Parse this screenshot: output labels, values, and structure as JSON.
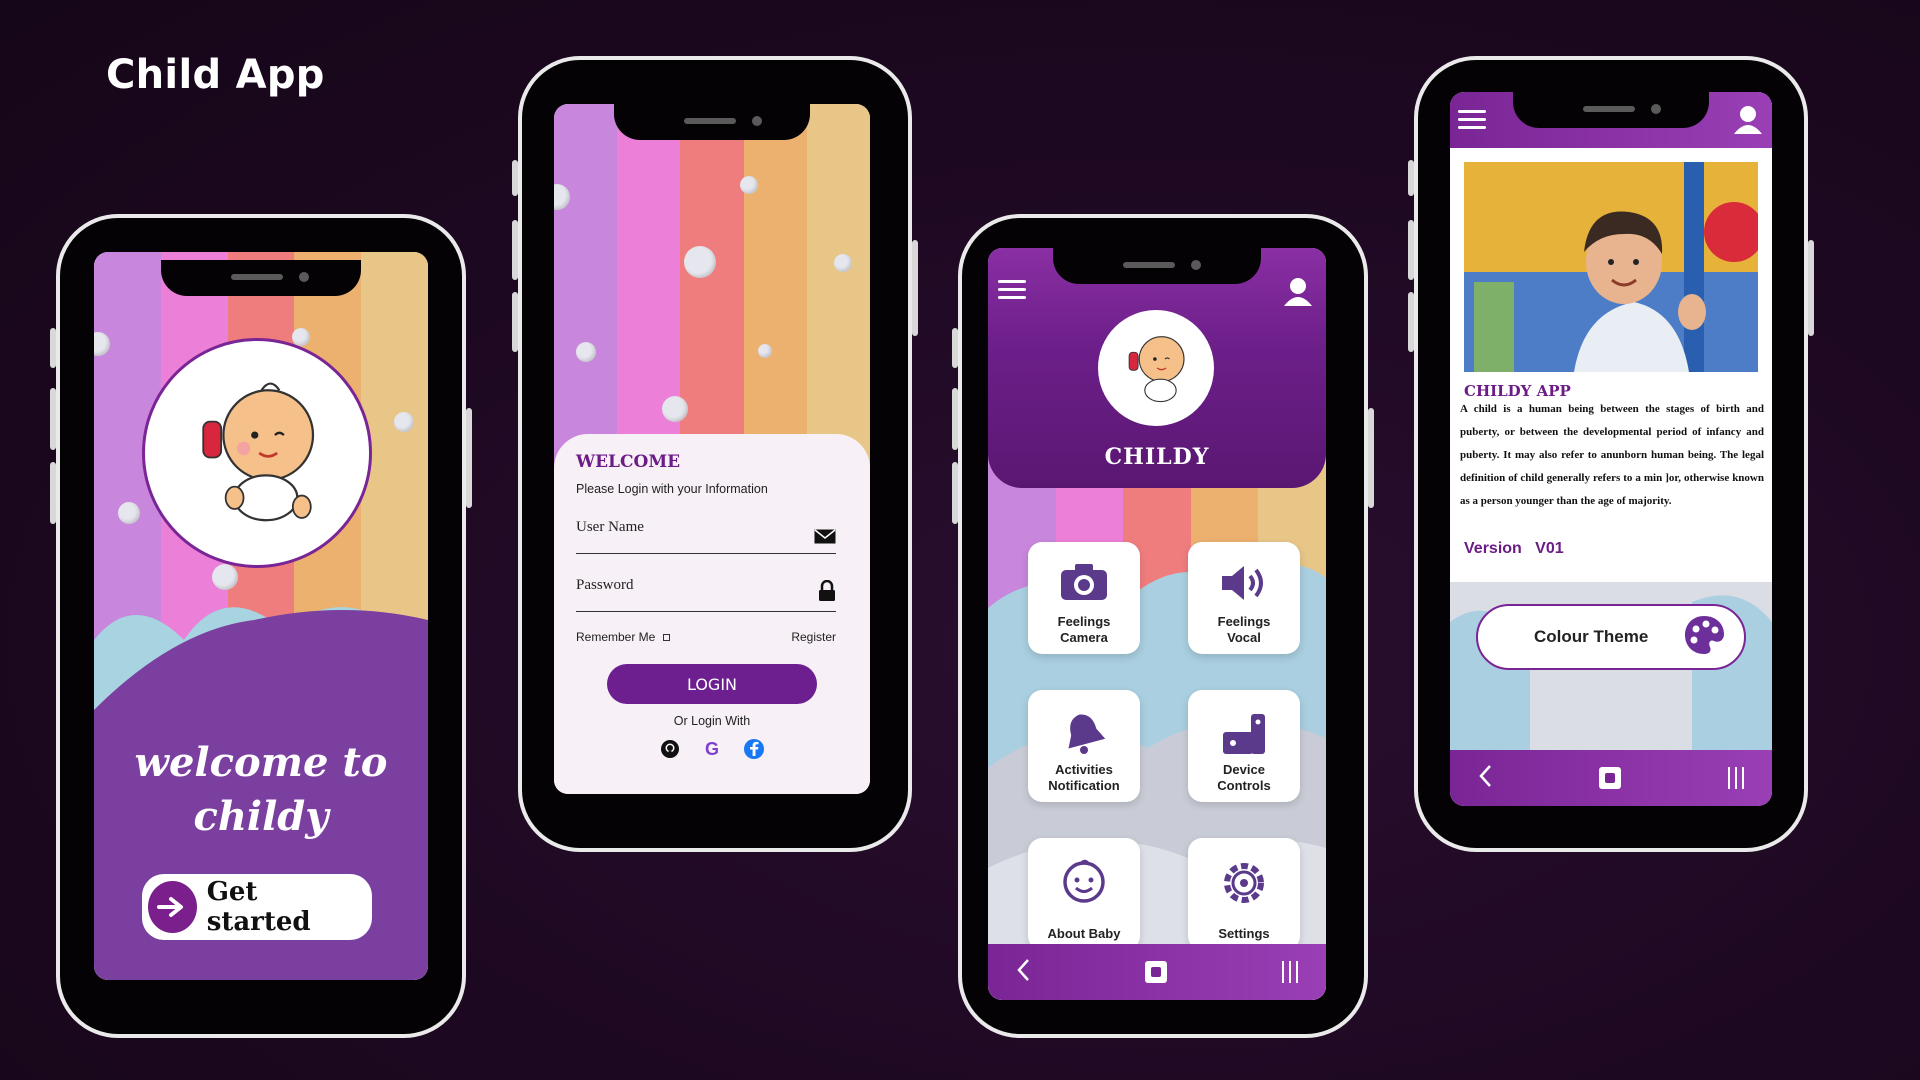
{
  "page": {
    "title": "Child App"
  },
  "phone1": {
    "welcome_line1": "welcome to",
    "welcome_line2": "childy",
    "get_started": "Get started"
  },
  "phone2": {
    "title": "WELCOME",
    "subtitle": "Please Login with your Information",
    "username_label": "User Name",
    "password_label": "Password",
    "remember_me": "Remember Me",
    "register": "Register",
    "login_button": "LOGIN",
    "or_login_with": "Or Login With",
    "socials": [
      "github-icon",
      "google-icon",
      "facebook-icon"
    ]
  },
  "phone3": {
    "app_name": "CHILDY",
    "tiles": [
      {
        "label": "Feelings\nCamera",
        "icon": "camera-icon"
      },
      {
        "label": "Feelings\nVocal",
        "icon": "speaker-icon"
      },
      {
        "label": "Activities\nNotification",
        "icon": "bell-icon"
      },
      {
        "label": "Device\nControls",
        "icon": "device-controls-icon"
      },
      {
        "label": "About Baby",
        "icon": "baby-face-icon"
      },
      {
        "label": "Settings",
        "icon": "gear-icon"
      }
    ]
  },
  "phone4": {
    "title": "CHILDY APP",
    "body": "A child is a human being between the  stages of birth and puberty, or between  the developmental period of infancy and puberty. It may also refer to anunborn human being. The legal definition of child generally refers to a min ]or, otherwise known as a person younger than the age of majority.",
    "version_label": "Version",
    "version_value": "V01",
    "colour_theme": "Colour Theme"
  },
  "colors": {
    "brand_purple": "#6d1f8f",
    "background": "#1d0821"
  }
}
